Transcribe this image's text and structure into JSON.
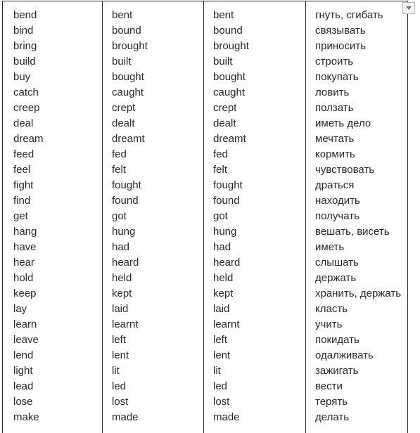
{
  "page": {
    "title": "Irregular verbs table",
    "background_color": "#ffffff",
    "text_color": "#2a2a2a",
    "border_color": "#2b2b2b"
  },
  "controls": {
    "scroll_down_button": {
      "icon": "chevron-down-icon",
      "label": "",
      "border_color": "#b9b9b9",
      "fill_color": "#f3f3f3",
      "arrow_color": "#6e6e6e"
    }
  },
  "table": {
    "columns": [
      {
        "key": "infinitive",
        "header": ""
      },
      {
        "key": "past",
        "header": ""
      },
      {
        "key": "participle",
        "header": ""
      },
      {
        "key": "translation",
        "header": ""
      }
    ],
    "row_count": 26,
    "rows": [
      {
        "infinitive": "bend",
        "past": "bent",
        "participle": "bent",
        "translation": "гнуть, сгибать"
      },
      {
        "infinitive": "bind",
        "past": "bound",
        "participle": "bound",
        "translation": "связывать"
      },
      {
        "infinitive": "bring",
        "past": "brought",
        "participle": "brought",
        "translation": "приносить"
      },
      {
        "infinitive": "build",
        "past": "built",
        "participle": "built",
        "translation": "строить"
      },
      {
        "infinitive": "buy",
        "past": "bought",
        "participle": "bought",
        "translation": "покупать"
      },
      {
        "infinitive": "catch",
        "past": "caught",
        "participle": "caught",
        "translation": "ловить"
      },
      {
        "infinitive": "creep",
        "past": "crept",
        "participle": "crept",
        "translation": "ползать"
      },
      {
        "infinitive": "deal",
        "past": "dealt",
        "participle": "dealt",
        "translation": "иметь дело"
      },
      {
        "infinitive": "dream",
        "past": "dreamt",
        "participle": "dreamt",
        "translation": "мечтать"
      },
      {
        "infinitive": "feed",
        "past": "fed",
        "participle": "fed",
        "translation": "кормить"
      },
      {
        "infinitive": "feel",
        "past": "felt",
        "participle": "felt",
        "translation": "чувствовать"
      },
      {
        "infinitive": "fight",
        "past": "fought",
        "participle": "fought",
        "translation": "драться"
      },
      {
        "infinitive": "find",
        "past": "found",
        "participle": "found",
        "translation": "находить"
      },
      {
        "infinitive": "get",
        "past": "got",
        "participle": "got",
        "translation": "получать"
      },
      {
        "infinitive": "hang",
        "past": "hung",
        "participle": "hung",
        "translation": "вешать, висеть"
      },
      {
        "infinitive": "have",
        "past": "had",
        "participle": "had",
        "translation": "иметь"
      },
      {
        "infinitive": "hear",
        "past": "heard",
        "participle": "heard",
        "translation": "слышать"
      },
      {
        "infinitive": "hold",
        "past": "held",
        "participle": "held",
        "translation": "держать"
      },
      {
        "infinitive": "keep",
        "past": "kept",
        "participle": "kept",
        "translation": "хранить, держать"
      },
      {
        "infinitive": "lay",
        "past": "laid",
        "participle": "laid",
        "translation": "класть"
      },
      {
        "infinitive": "learn",
        "past": "learnt",
        "participle": "learnt",
        "translation": "учить"
      },
      {
        "infinitive": "leave",
        "past": "left",
        "participle": "left",
        "translation": "покидать"
      },
      {
        "infinitive": "lend",
        "past": "lent",
        "participle": "lent",
        "translation": "одалживать"
      },
      {
        "infinitive": "light",
        "past": "lit",
        "participle": "lit",
        "translation": "зажигать"
      },
      {
        "infinitive": "lead",
        "past": "led",
        "participle": "led",
        "translation": "вести"
      },
      {
        "infinitive": "lose",
        "past": "lost",
        "participle": "lost",
        "translation": "терять"
      },
      {
        "infinitive": "make",
        "past": "made",
        "participle": "made",
        "translation": "делать"
      }
    ]
  }
}
